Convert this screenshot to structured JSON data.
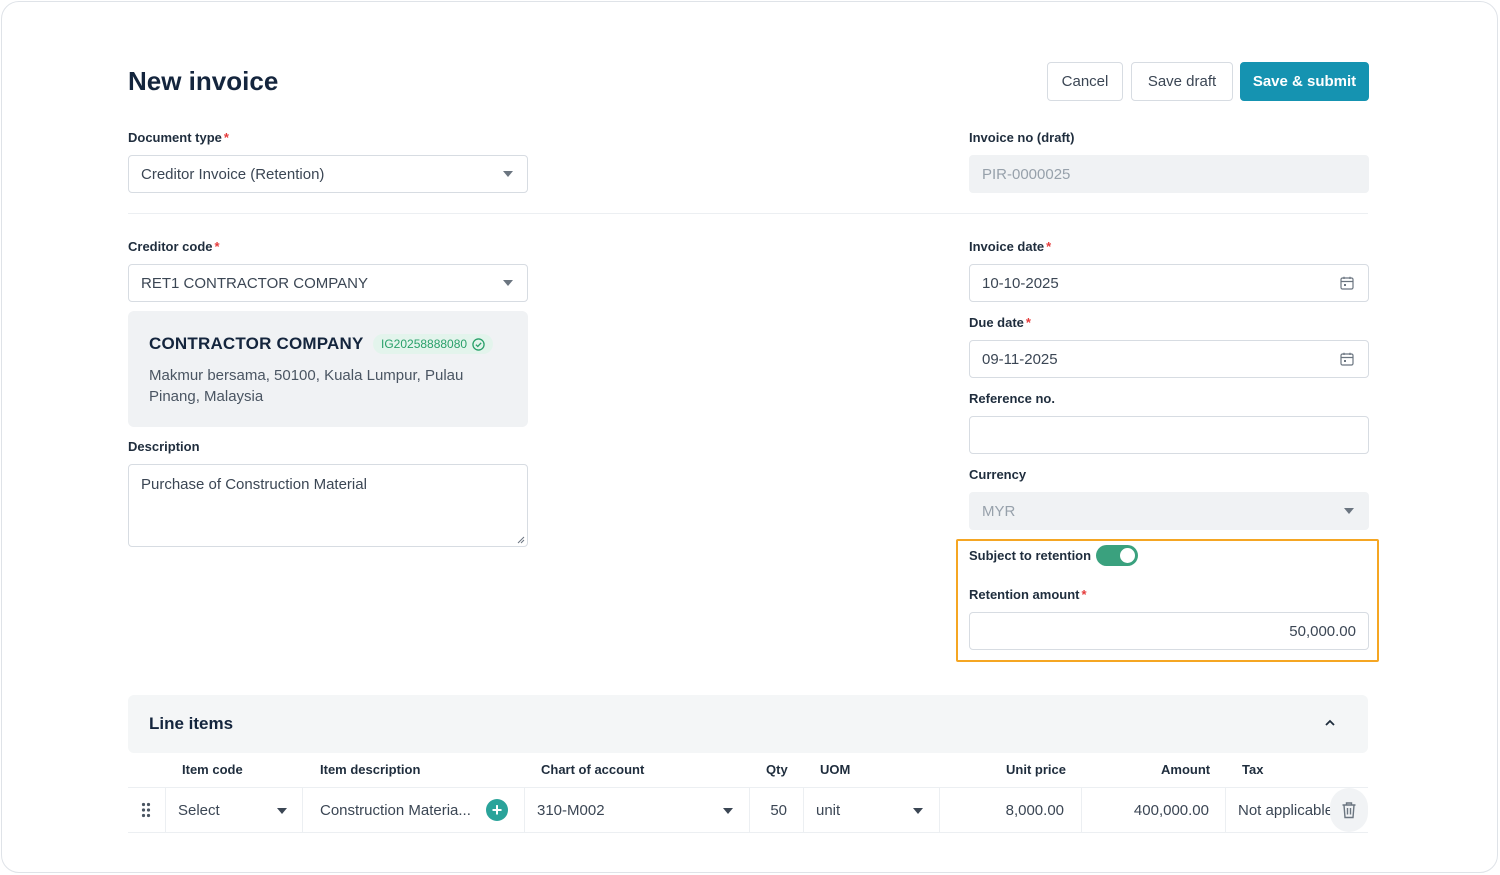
{
  "page": {
    "title": "New invoice"
  },
  "actions": {
    "cancel": "Cancel",
    "save_draft": "Save draft",
    "save_submit": "Save & submit"
  },
  "form": {
    "document_type": {
      "label": "Document type",
      "required": "*",
      "value": "Creditor Invoice (Retention)"
    },
    "invoice_no": {
      "label": "Invoice no (draft)",
      "value": "PIR-0000025"
    },
    "creditor_code": {
      "label": "Creditor code",
      "required": "*",
      "value": "RET1 CONTRACTOR COMPANY"
    },
    "creditor_card": {
      "name": "CONTRACTOR COMPANY",
      "tax_id": "IG20258888080",
      "address": "Makmur bersama, 50100, Kuala Lumpur, Pulau Pinang, Malaysia"
    },
    "description": {
      "label": "Description",
      "value": "Purchase of Construction Material"
    },
    "invoice_date": {
      "label": "Invoice date",
      "required": "*",
      "value": "10-10-2025"
    },
    "due_date": {
      "label": "Due date",
      "required": "*",
      "value": "09-11-2025"
    },
    "reference_no": {
      "label": "Reference no.",
      "value": ""
    },
    "currency": {
      "label": "Currency",
      "value": "MYR"
    },
    "retention": {
      "toggle_label": "Subject to retention",
      "enabled": true,
      "amount_label": "Retention amount",
      "required": "*",
      "amount": "50,000.00"
    }
  },
  "line_items": {
    "title": "Line items",
    "columns": [
      "Item code",
      "Item description",
      "Chart of account",
      "Qty",
      "UOM",
      "Unit price",
      "Amount",
      "Tax"
    ],
    "rows": [
      {
        "item_code": "Select",
        "item_description": "Construction Materia...",
        "chart_of_account": "310-M002",
        "qty": "50",
        "uom": "unit",
        "unit_price": "8,000.00",
        "amount": "400,000.00",
        "tax": "Not applicable"
      }
    ]
  },
  "colors": {
    "primary": "#1593b1",
    "toggle_on": "#3aa17e",
    "highlight": "#f5a623",
    "required": "#e53b3b",
    "badge_text": "#2aa06a"
  }
}
